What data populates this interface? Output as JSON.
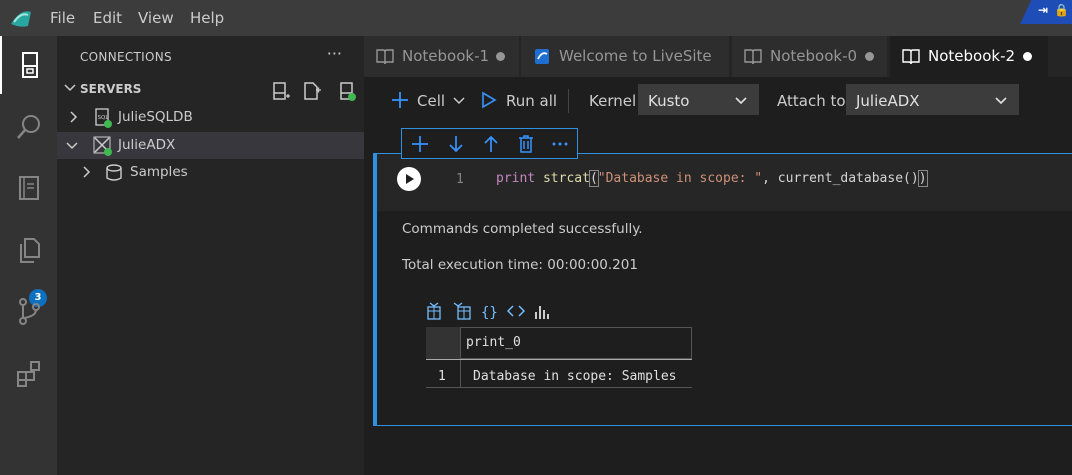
{
  "menu": {
    "file": "File",
    "edit": "Edit",
    "view": "View",
    "help": "Help"
  },
  "activity_bar": {
    "items": [
      "connections-icon",
      "search-icon",
      "notebook-icon",
      "explorer-icon",
      "source-control-icon",
      "extensions-icon"
    ],
    "badge": "3"
  },
  "sidebar": {
    "title": "CONNECTIONS",
    "more": "···",
    "servers_label": "SERVERS",
    "tree": [
      {
        "label": "JulieSQLDB",
        "icon": "sql-server-icon",
        "expanded": false
      },
      {
        "label": "JulieADX",
        "icon": "adx-server-icon",
        "expanded": true
      },
      {
        "label": "Samples",
        "icon": "database-icon",
        "expanded": false
      }
    ]
  },
  "tabs": [
    {
      "label": "Notebook-1",
      "icon": "book-icon",
      "dirty": true
    },
    {
      "label": "Welcome to LiveSite",
      "icon": "azure-data-studio-icon",
      "dirty": false
    },
    {
      "label": "Notebook-0",
      "icon": "book-icon",
      "dirty": true
    },
    {
      "label": "Notebook-2",
      "icon": "book-icon",
      "dirty": true,
      "active": true
    }
  ],
  "toolbar": {
    "cell_label": "Cell",
    "run_all_label": "Run all",
    "kernel_label": "Kernel",
    "kernel_value": "Kusto",
    "attach_label": "Attach to",
    "attach_value": "JulieADX"
  },
  "cell": {
    "line_number": "1",
    "code": {
      "keyword": "print",
      "func": "strcat",
      "open": "(",
      "string": "\"Database in scope: \"",
      "rest": ", current_database()",
      "close": ")"
    },
    "output": {
      "message": "Commands completed successfully.",
      "execution_time": "Total execution time: 00:00:00.201"
    },
    "result_icons": [
      "save-as-csv-icon",
      "save-as-excel-icon",
      "save-as-json-icon",
      "save-as-xml-icon",
      "chart-icon"
    ],
    "grid": {
      "columns": [
        "print_0"
      ],
      "rows": [
        {
          "num": "1",
          "values": [
            "Database in scope: Samples"
          ]
        }
      ]
    }
  },
  "colors": {
    "accent": "#2f8fe0",
    "badge": "#0e70c0",
    "status_dot_green": "#3fb950"
  }
}
